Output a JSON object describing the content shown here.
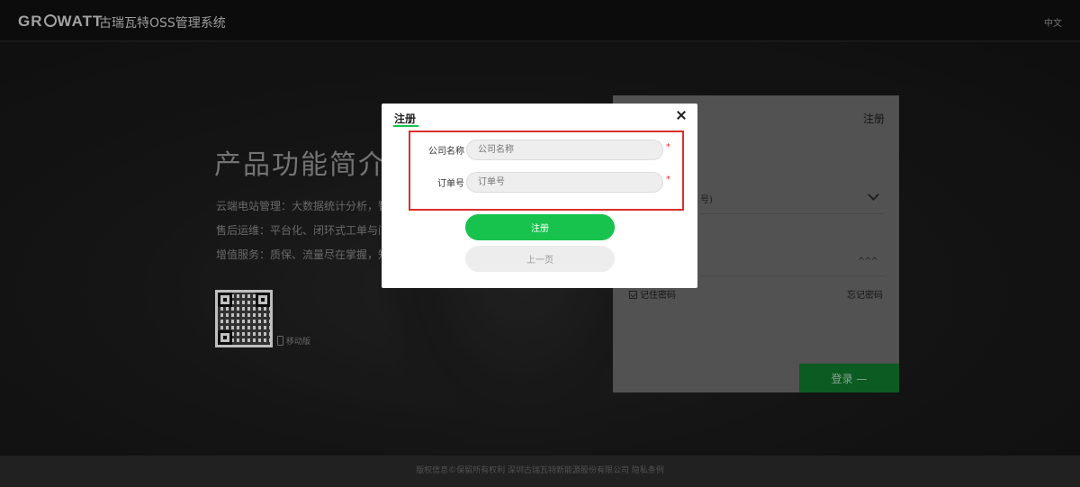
{
  "header": {
    "logo_text_before": "GR",
    "logo_text_after": "WATT",
    "app_title": "古瑞瓦特OSS管理系统",
    "language": "中文"
  },
  "hero": {
    "title": "产品功能简介",
    "lines": [
      "云端电站管理：大数据统计分析，智能",
      "售后运维：平台化、闭环式工单与问题",
      "增值服务：质保、流量尽在掌握，知识"
    ],
    "mobile_label": "移动版"
  },
  "login_panel": {
    "register_link": "注册",
    "account_field_text": "号)",
    "remember_label": "记住密码",
    "forgot_label": "忘记密码",
    "login_button": "登录 —",
    "password_eye_glyph": "^^^"
  },
  "footer": {
    "text": "版权信息©保留所有权利 深圳古瑞瓦特新能源股份有限公司  隐私条例"
  },
  "modal": {
    "title": "注册",
    "close_icon": "close-icon",
    "fields": [
      {
        "label": "公司名称",
        "placeholder": "公司名称",
        "value": "",
        "required_mark": "*"
      },
      {
        "label": "订单号",
        "placeholder": "订单号",
        "value": "",
        "required_mark": "*"
      }
    ],
    "register_button": "注册",
    "previous_button": "上一页"
  },
  "colors": {
    "accent_green": "#17c24d",
    "highlight_red": "#d9302a",
    "required_red": "#e0332b"
  }
}
